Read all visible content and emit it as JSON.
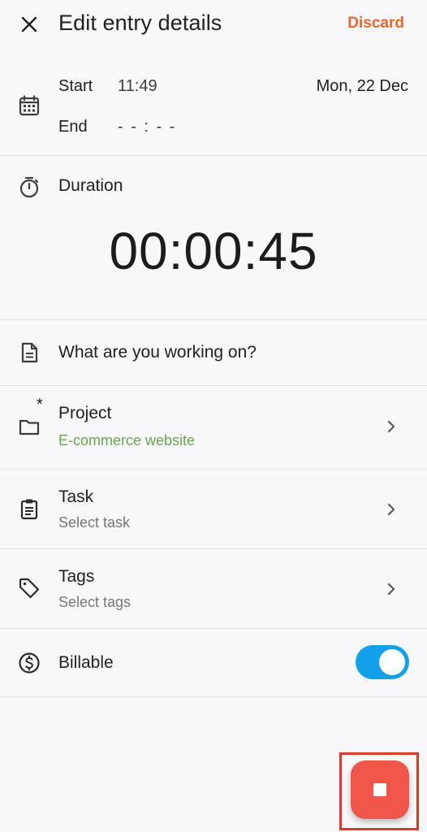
{
  "header": {
    "title": "Edit entry details",
    "discard_label": "Discard"
  },
  "time": {
    "start_label": "Start",
    "start_value": "11:49",
    "date": "Mon, 22 Dec",
    "end_label": "End",
    "end_value": "- - : - -"
  },
  "duration": {
    "label": "Duration",
    "value": "00:00:45"
  },
  "description": {
    "placeholder": "What are you working on?"
  },
  "project": {
    "label": "Project",
    "required_marker": "*",
    "value": "E-commerce website",
    "value_color": "#6aa84f"
  },
  "task": {
    "label": "Task",
    "placeholder": "Select task"
  },
  "tags": {
    "label": "Tags",
    "placeholder": "Select tags"
  },
  "billable": {
    "label": "Billable",
    "enabled": true,
    "toggle_color": "#12a0e8"
  },
  "fab": {
    "icon": "stop-icon",
    "color": "#f0554a"
  },
  "accent": {
    "discard_color": "#e4682f"
  }
}
